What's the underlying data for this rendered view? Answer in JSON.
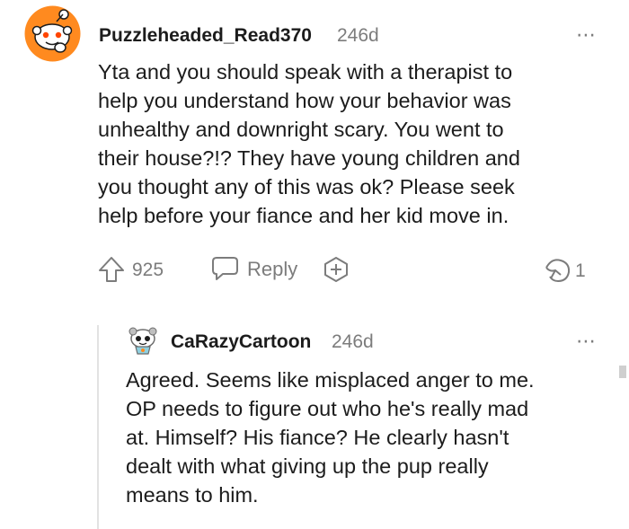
{
  "comment": {
    "username": "Puzzleheaded_Read370",
    "age": "246d",
    "more_icon": "⋯",
    "lines": [
      "Yta and you should speak with a therapist to",
      "help you understand how your behavior was",
      "unhealthy and downright scary. You went to",
      "their house?!? They have young children and",
      "you thought any of this was ok? Please seek",
      "help before your fiance and her kid move in."
    ],
    "votes": "925",
    "reply_label": "Reply",
    "award_count": "1"
  },
  "reply": {
    "username": "CaRazyCartoon",
    "age": "246d",
    "more_icon": "⋯",
    "lines": [
      "Agreed. Seems like misplaced anger to me.",
      "OP needs to figure out who he's really mad",
      "at. Himself? His fiance? He clearly hasn't",
      "dealt with what giving up the pup really",
      "means to him."
    ]
  },
  "colors": {
    "text": "#1c1c1c",
    "meta": "#7c7c7c",
    "avatar_orange": "#ff8a1f",
    "thread_line": "#e2e2e2"
  }
}
